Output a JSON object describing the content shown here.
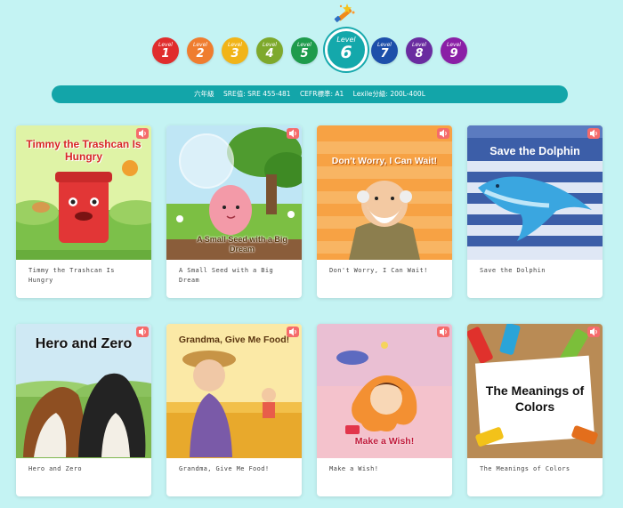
{
  "top_icon": "magic-wand-icon",
  "levels": [
    {
      "word": "Level",
      "num": "1",
      "color": "#e02d2d"
    },
    {
      "word": "Level",
      "num": "2",
      "color": "#ef7d2f"
    },
    {
      "word": "Level",
      "num": "3",
      "color": "#f1b418"
    },
    {
      "word": "Level",
      "num": "4",
      "color": "#7ea92c"
    },
    {
      "word": "Level",
      "num": "5",
      "color": "#1e9b4c"
    },
    {
      "word": "Level",
      "num": "6",
      "color": "#14a8ab",
      "active": true
    },
    {
      "word": "Level",
      "num": "7",
      "color": "#1d4faa"
    },
    {
      "word": "Level",
      "num": "8",
      "color": "#6a2ca0"
    },
    {
      "word": "Level",
      "num": "9",
      "color": "#8a1fa6"
    }
  ],
  "info": {
    "grade": "六年級",
    "sre": "SRE值: SRE 455-481",
    "cefr": "CEFR標準: A1",
    "lexile": "Lexile分級: 200L-400L"
  },
  "books": [
    {
      "cover_title": "Timmy the Trashcan Is Hungry",
      "caption": "Timmy the Trashcan Is Hungry"
    },
    {
      "cover_title": "A Small Seed with a Big Dream",
      "caption": "A Small Seed with a Big Dream"
    },
    {
      "cover_title": "Don't Worry, I Can Wait!",
      "caption": "Don't Worry, I Can Wait!"
    },
    {
      "cover_title": "Save the Dolphin",
      "caption": "Save the Dolphin"
    },
    {
      "cover_title": "Hero and Zero",
      "caption": "Hero and Zero"
    },
    {
      "cover_title": "Grandma, Give Me Food!",
      "caption": "Grandma, Give Me Food!"
    },
    {
      "cover_title": "Make a Wish!",
      "caption": "Make a Wish!"
    },
    {
      "cover_title": "The Meanings of Colors",
      "caption": "The Meanings of Colors"
    }
  ]
}
